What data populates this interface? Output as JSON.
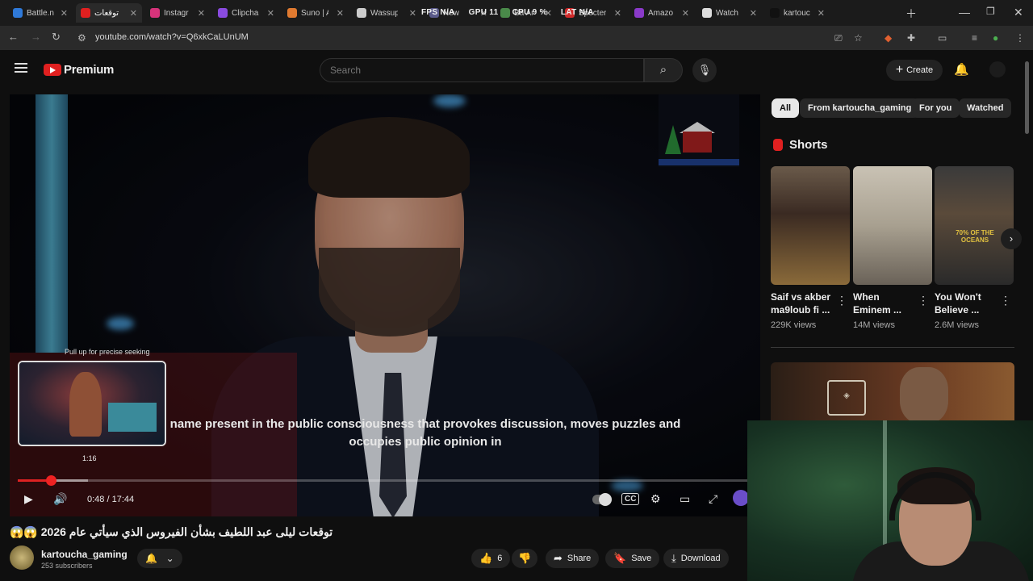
{
  "browser": {
    "tabs": [
      {
        "title": "Battle.n",
        "color": "#2f79d8",
        "active": false
      },
      {
        "title": "توقعات",
        "color": "#e02020",
        "active": true
      },
      {
        "title": "Instagr",
        "color": "#d6337a",
        "active": false
      },
      {
        "title": "Clipcha",
        "color": "#8a4be0",
        "active": false
      },
      {
        "title": "Suno | A",
        "color": "#e07a30",
        "active": false
      },
      {
        "title": "Wassup",
        "color": "#cccccc",
        "active": false
      },
      {
        "title": "New",
        "color": "#5a5a8a",
        "active": false
      },
      {
        "title": "Ba Ar",
        "color": "#4a8a4a",
        "active": false
      },
      {
        "title": "Specter",
        "color": "#d02a2a",
        "active": false
      },
      {
        "title": "Amazo",
        "color": "#8a3ac9",
        "active": false
      },
      {
        "title": "Watch",
        "color": "#dddddd",
        "active": false
      },
      {
        "title": "kartouc",
        "color": "#111111",
        "active": false
      }
    ],
    "overlay_stats": {
      "fps": "FPS  N/A",
      "gpu": "GPU  11",
      "cpu": "CPU  9 %",
      "lat": "LAT  N/A"
    },
    "url": "youtube.com/watch?v=Q6xkCaLUnUM"
  },
  "header": {
    "logo_text": "Premium",
    "search_placeholder": "Search",
    "create_label": "Create"
  },
  "player": {
    "seek_hint": "Pull up for precise seeking",
    "preview_time": "1:16",
    "caption_line1": "name present in the public consciousness that provokes discussion, moves puzzles and",
    "caption_line2": "occupies public opinion in",
    "current_time": "0:48",
    "duration": "17:44",
    "time_display": "0:48 / 17:44",
    "progress_fraction": 0.045,
    "buffered_fraction": 0.095
  },
  "video": {
    "title": "توقعات ليلى عبد اللطيف بشأن الفيروس الذي سيأتي عام 2026 😱😱",
    "channel_name": "kartoucha_gaming",
    "subscribers": "253 subscribers",
    "likes": "6",
    "share_label": "Share",
    "save_label": "Save",
    "download_label": "Download"
  },
  "sidebar": {
    "chips": [
      "All",
      "From kartoucha_gaming",
      "For you",
      "Watched"
    ],
    "shorts_heading": "Shorts",
    "shorts": [
      {
        "title": "Saif vs akber ma9loub fi ...",
        "views": "229K views"
      },
      {
        "title": "When Eminem ...",
        "views": "14M views"
      },
      {
        "title": "You Won't Believe ...",
        "views": "2.6M views"
      }
    ],
    "short_overlay_text": "70% OF THE OCEANS"
  }
}
